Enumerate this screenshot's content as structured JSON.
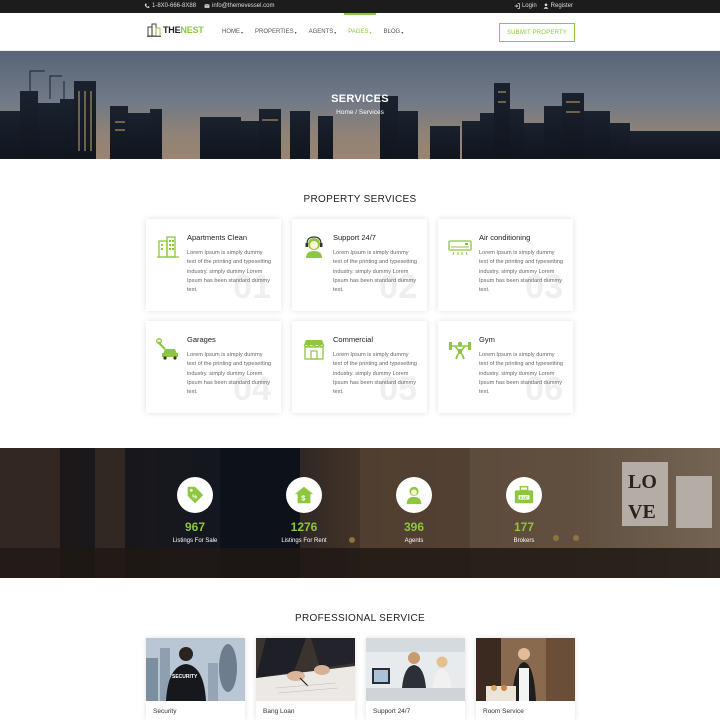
{
  "topbar": {
    "phone": "1-8X0-666-8X88",
    "email": "info@themevessel.com",
    "login": "Login",
    "register": "Register"
  },
  "header": {
    "logo_the": "THE",
    "logo_nest": "NEST",
    "nav": [
      {
        "label": "HOME",
        "active": false
      },
      {
        "label": "PROPERTIES",
        "active": false
      },
      {
        "label": "AGENTS",
        "active": false
      },
      {
        "label": "PAGES",
        "active": true
      },
      {
        "label": "BLOG",
        "active": false
      }
    ],
    "submit_label": "SUBMIT PROPERTY"
  },
  "hero": {
    "title": "SERVICES",
    "breadcrumb": "Home  /  Services"
  },
  "property_services": {
    "title": "PROPERTY SERVICES",
    "cards": [
      {
        "title": "Apartments Clean",
        "icon": "building-icon",
        "number": "01",
        "body": "Lorem Ipsum is simply dummy text of the printing and typesetting industry. simply dummy Lorem Ipsum has been standard dummy text."
      },
      {
        "title": "Support 24/7",
        "icon": "support-agent-icon",
        "number": "02",
        "body": "Lorem Ipsum is simply dummy text of the printing and typesetting industry. simply dummy Lorem Ipsum has been standard dummy text."
      },
      {
        "title": "Air conditioning",
        "icon": "air-conditioner-icon",
        "number": "03",
        "body": "Lorem Ipsum is simply dummy text of the printing and typesetting industry. simply dummy Lorem Ipsum has been standard dummy text."
      },
      {
        "title": "Garages",
        "icon": "car-wrench-icon",
        "number": "04",
        "body": "Lorem Ipsum is simply dummy text of the printing and typesetting industry. simply dummy Lorem Ipsum has been standard dummy text."
      },
      {
        "title": "Commercial",
        "icon": "storefront-icon",
        "number": "05",
        "body": "Lorem Ipsum is simply dummy text of the printing and typesetting industry. simply dummy Lorem Ipsum has been standard dummy text."
      },
      {
        "title": "Gym",
        "icon": "weightlifter-icon",
        "number": "06",
        "body": "Lorem Ipsum is simply dummy text of the printing and typesetting industry. simply dummy Lorem Ipsum has been standard dummy text."
      }
    ]
  },
  "stats": [
    {
      "value": "967",
      "label": "Listings For Sale",
      "icon": "sale-tag-icon"
    },
    {
      "value": "1276",
      "label": "Listings For Rent",
      "icon": "rent-house-icon"
    },
    {
      "value": "396",
      "label": "Agents",
      "icon": "agent-icon"
    },
    {
      "value": "177",
      "label": "Brokers",
      "icon": "briefcase-icon"
    }
  ],
  "professional_service": {
    "title": "PROFESSIONAL SERVICE",
    "cards": [
      {
        "title": "Security"
      },
      {
        "title": "Bang Loan"
      },
      {
        "title": "Support 24/7"
      },
      {
        "title": "Room Service"
      }
    ]
  },
  "colors": {
    "accent": "#8dc63f",
    "topbar": "#1c1c1c"
  }
}
